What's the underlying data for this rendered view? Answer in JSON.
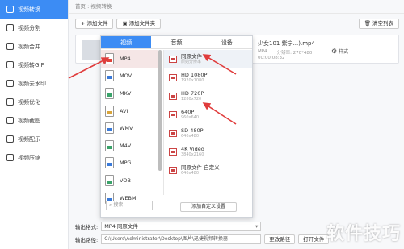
{
  "sidebar": {
    "items": [
      {
        "label": "视频转换",
        "active": true
      },
      {
        "label": "视频分割"
      },
      {
        "label": "视频合并"
      },
      {
        "label": "视频转GIF"
      },
      {
        "label": "视频去水印"
      },
      {
        "label": "视频优化"
      },
      {
        "label": "视频截图"
      },
      {
        "label": "视频配乐"
      },
      {
        "label": "视频压缩"
      }
    ]
  },
  "breadcrumb": "首页 : 视频转换",
  "toolbar": {
    "add_file": "添加文件",
    "add_folder": "添加文件夹",
    "clear_list": "清空列表"
  },
  "file": {
    "name": "少女101 紫宁...).mp4",
    "meta_a": "MP4",
    "meta_b": "分辨率: 270*480",
    "duration": "00:00:08:32",
    "style_label": "样式"
  },
  "panel": {
    "tabs": [
      "视频",
      "音频",
      "设备"
    ],
    "active_tab": "视频",
    "formats": [
      "MP4",
      "MOV",
      "MKV",
      "AVI",
      "WMV",
      "M4V",
      "MPG",
      "VOB",
      "WEBM"
    ],
    "format_colors": [
      "#e0433a",
      "#3a7ad9",
      "#3aa36a",
      "#d9a53a",
      "#3a7ad9",
      "#3aa36a",
      "#3a7ad9",
      "#3aa36a",
      "#3a7ad9"
    ],
    "selected_format": "MP4",
    "search_placeholder": "搜索",
    "resolutions": [
      {
        "name": "同原文件",
        "sub": "原始分辨率"
      },
      {
        "name": "HD 1080P",
        "sub": "1920x1080"
      },
      {
        "name": "HD 720P",
        "sub": "1280x720"
      },
      {
        "name": "640P",
        "sub": "960x640"
      },
      {
        "name": "SD 480P",
        "sub": "640x480"
      },
      {
        "name": "4K Video",
        "sub": "3840x2160"
      },
      {
        "name": "同原文件 自定义",
        "sub": "640x480"
      }
    ],
    "custom_button": "添加自定义设置"
  },
  "bottom": {
    "format_label": "输出格式:",
    "format_value": "MP4 同原文件",
    "path_label": "输出路径:",
    "path_value": "C:\\Users\\Administrator\\Desktop\\图片\\迅捷视频转换器",
    "change_path": "更改路径",
    "open_folder": "打开文件"
  },
  "watermark": "软件技巧",
  "colors": {
    "accent": "#3c8cf4",
    "arrow": "#e03c3c"
  }
}
